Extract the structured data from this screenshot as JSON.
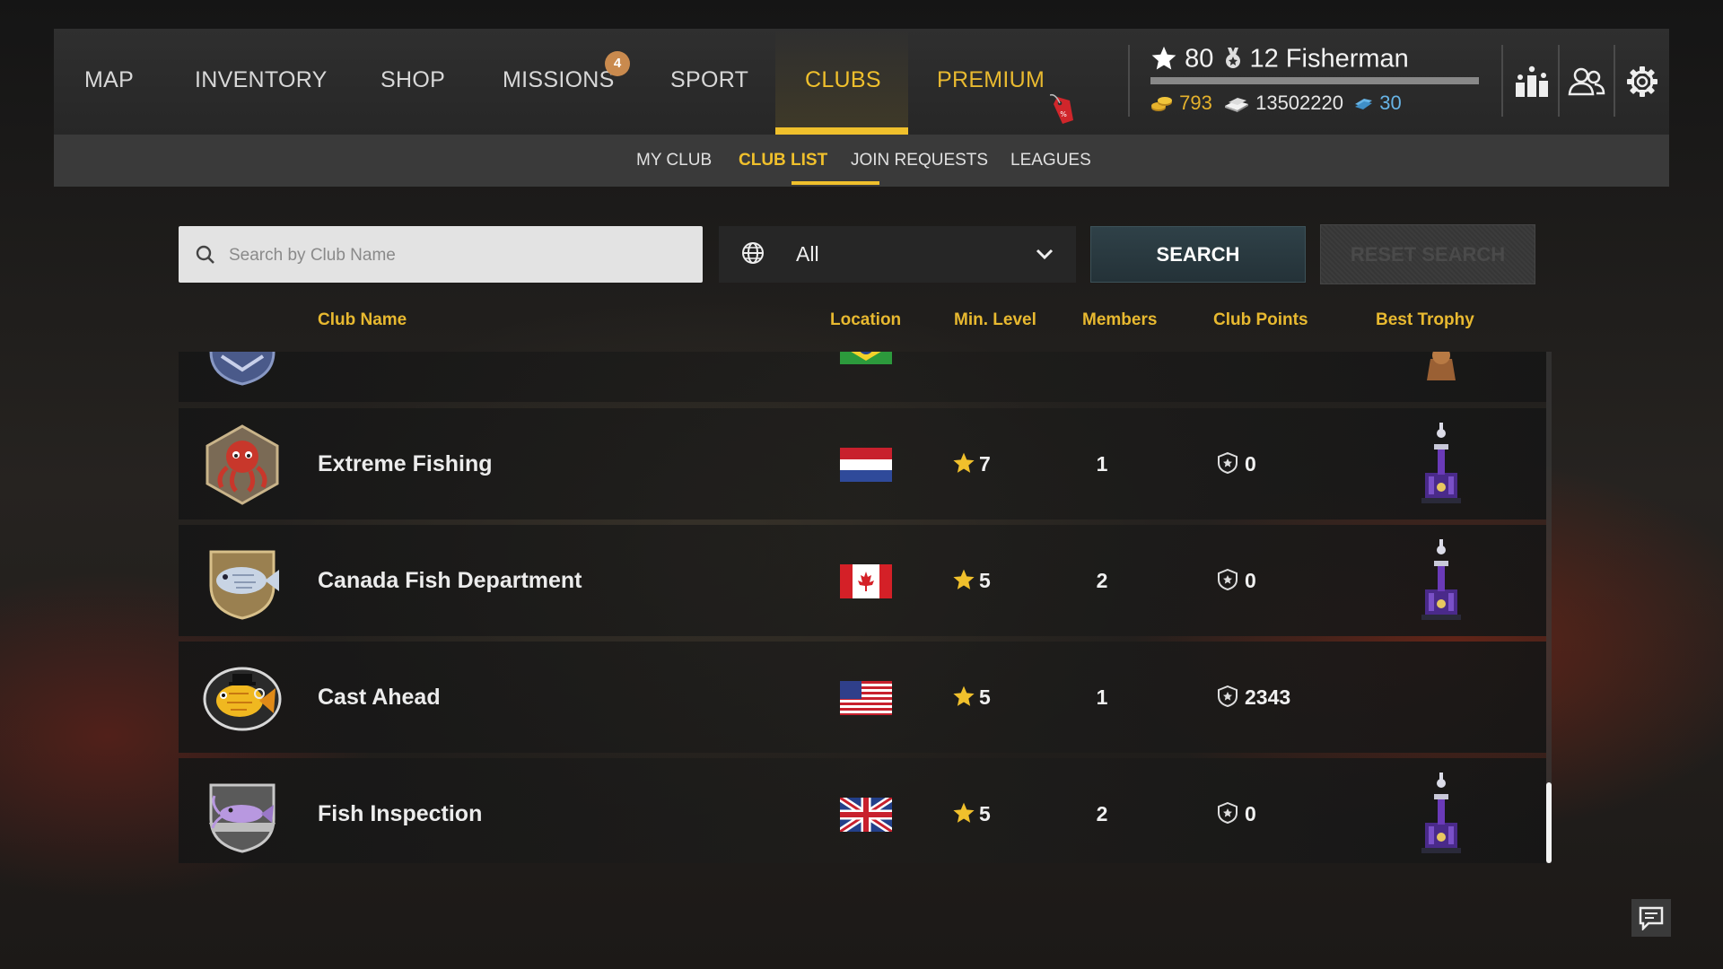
{
  "nav": {
    "tabs": [
      {
        "label": "MAP"
      },
      {
        "label": "INVENTORY"
      },
      {
        "label": "SHOP"
      },
      {
        "label": "MISSIONS",
        "badge": "4"
      },
      {
        "label": "SPORT"
      },
      {
        "label": "CLUBS",
        "active": true
      },
      {
        "label": "PREMIUM"
      }
    ],
    "premium_tag_icon": "sale-tag-icon"
  },
  "player": {
    "rank": "80",
    "level": "12",
    "title": "Fisherman",
    "gold": "793",
    "silver": "13502220",
    "baitcoins": "30",
    "xp_progress": 1.0
  },
  "icons": [
    "leaderboard-icon",
    "friends-icon",
    "settings-gear-icon",
    "chat-icon"
  ],
  "subnav": {
    "items": [
      {
        "label": "MY CLUB"
      },
      {
        "label": "CLUB LIST",
        "active": true
      },
      {
        "label": "JOIN REQUESTS"
      },
      {
        "label": "LEAGUES"
      }
    ]
  },
  "filters": {
    "search_placeholder": "Search by Club Name",
    "search_value": "",
    "location_value": "All",
    "search_button": "SEARCH",
    "reset_button": "RESET SEARCH"
  },
  "columns": {
    "name": "Club Name",
    "location": "Location",
    "min_level": "Min. Level",
    "members": "Members",
    "points": "Club Points",
    "trophy": "Best Trophy"
  },
  "clubs": [
    {
      "name": "",
      "emblem": "blue-shield-emblem",
      "flag": "brazil",
      "min_level": "",
      "members": "",
      "points": "",
      "trophy": "bronze",
      "partial": true
    },
    {
      "name": "Extreme Fishing",
      "emblem": "red-octopus-emblem",
      "flag": "netherlands",
      "min_level": "7",
      "members": "1",
      "points": "0",
      "trophy": "purple"
    },
    {
      "name": "Canada Fish Department",
      "emblem": "silver-fish-emblem",
      "flag": "canada",
      "min_level": "5",
      "members": "2",
      "points": "0",
      "trophy": "purple"
    },
    {
      "name": "Cast Ahead",
      "emblem": "gold-fish-emblem",
      "flag": "usa",
      "min_level": "5",
      "members": "1",
      "points": "2343",
      "trophy": ""
    },
    {
      "name": "Fish Inspection",
      "emblem": "purple-catfish-emblem",
      "flag": "uk",
      "min_level": "5",
      "members": "2",
      "points": "0",
      "trophy": "purple"
    }
  ],
  "colors": {
    "accent": "#f0c02c",
    "nav_bg": "#2f2f2f",
    "subnav_bg": "#3a3a3a",
    "row_bg": "#1c1c1c",
    "search_btn": "#2f4148"
  }
}
